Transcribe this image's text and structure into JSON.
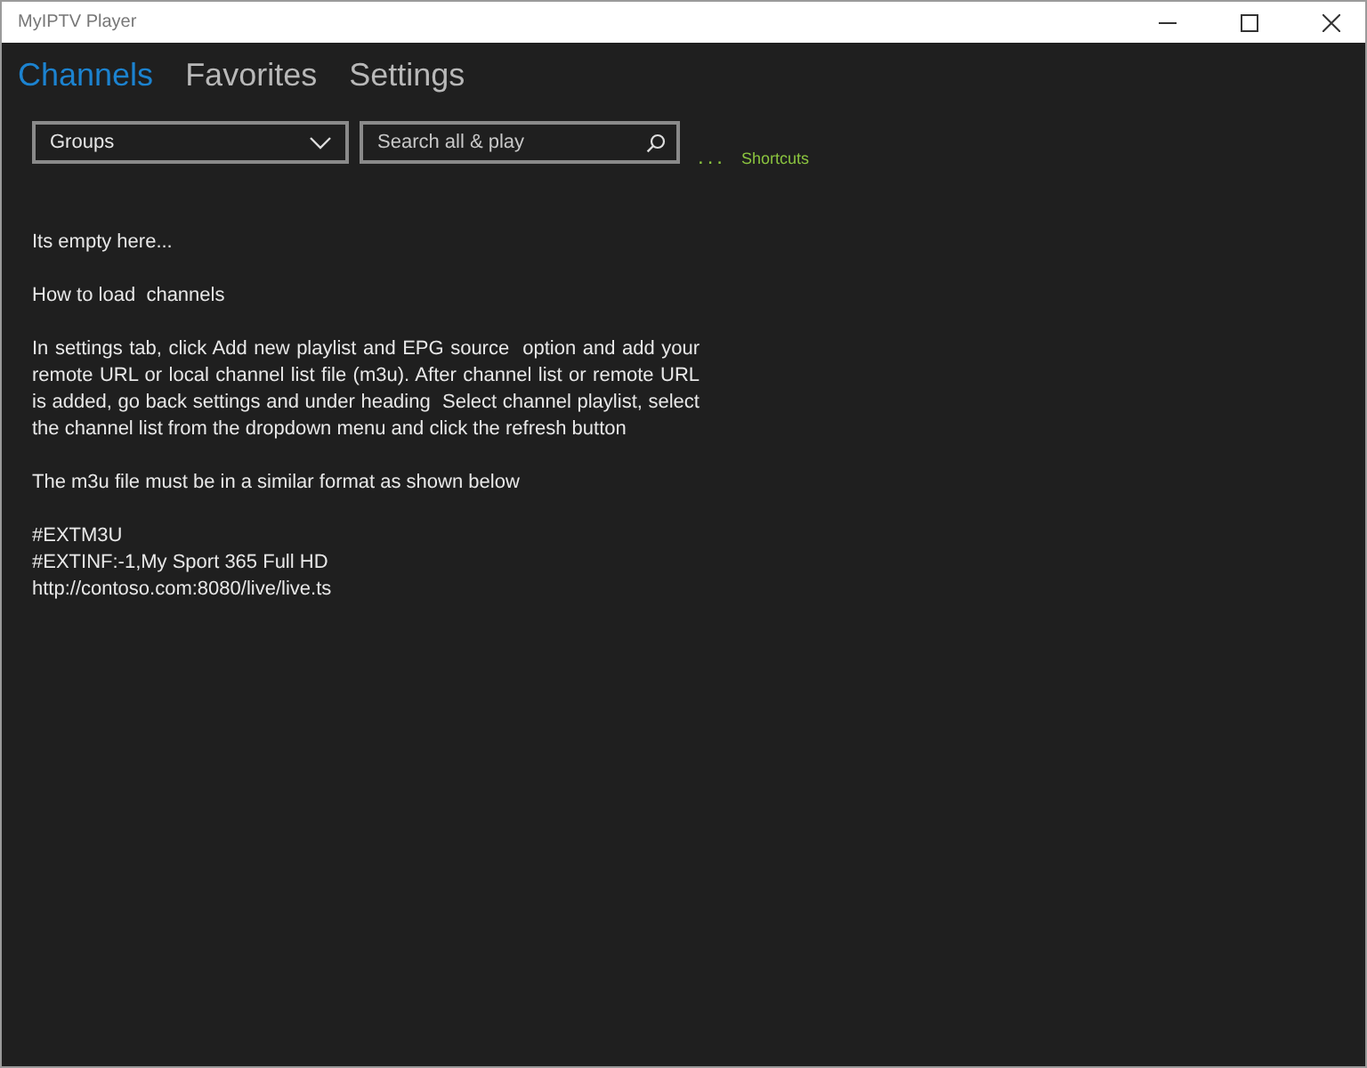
{
  "window": {
    "title": "MyIPTV Player"
  },
  "tabs": [
    {
      "label": "Channels",
      "selected": true
    },
    {
      "label": "Favorites",
      "selected": false
    },
    {
      "label": "Settings",
      "selected": false
    }
  ],
  "groups_dropdown": {
    "value": "Groups"
  },
  "search": {
    "placeholder": "Search all & play"
  },
  "shortcuts": {
    "dots": "...",
    "label": "Shortcuts"
  },
  "content": [
    {
      "kind": "line",
      "text": "Its empty here..."
    },
    {
      "kind": "line",
      "text": "How to load  channels"
    },
    {
      "kind": "paragraph",
      "text": "In settings tab, click Add new playlist and EPG source  option and add your remote URL or local channel list file (m3u). After channel list or remote URL is added, go back settings and under heading  Select channel playlist, select the channel list from the dropdown menu and click the refresh button"
    },
    {
      "kind": "line",
      "text": "The m3u file must be in a similar format as shown below"
    },
    {
      "kind": "code",
      "lines": [
        "#EXTM3U",
        "#EXTINF:-1,My Sport 365 Full HD",
        "http://contoso.com:8080/live/live.ts"
      ]
    }
  ]
}
